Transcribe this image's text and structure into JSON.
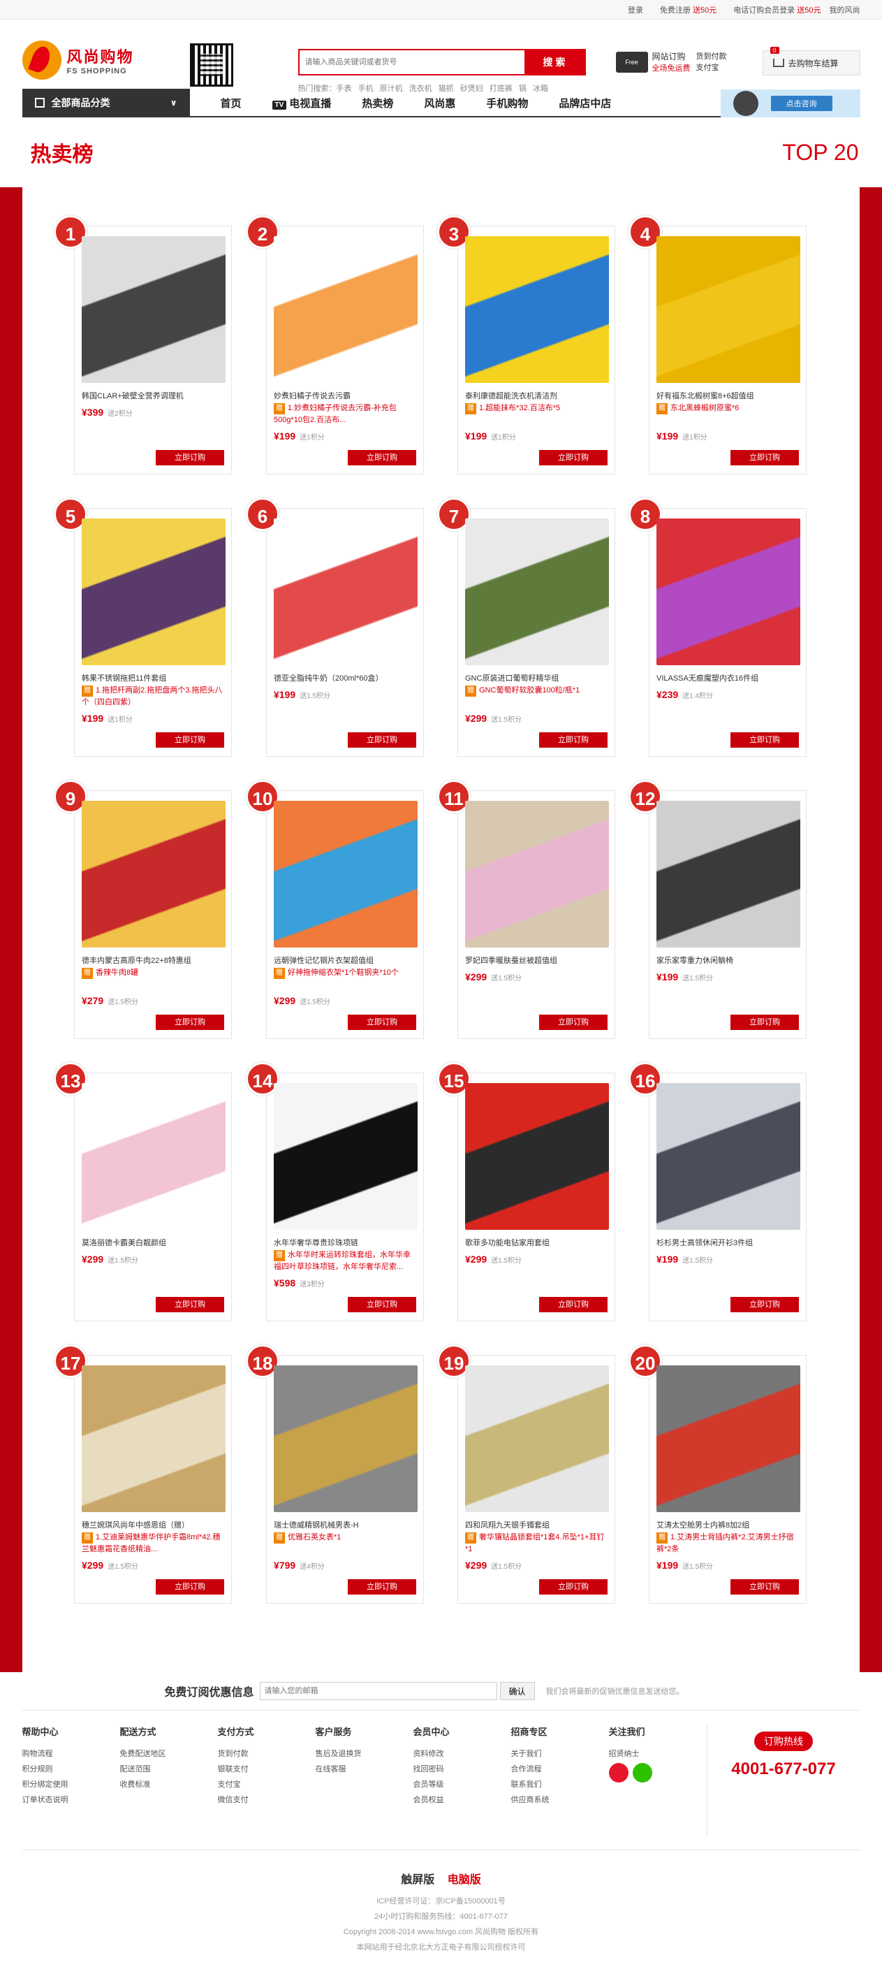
{
  "topbar": {
    "login": "登录",
    "register": "免费注册",
    "register_bonus": "送50元",
    "phone_member": "电话订购会员登录",
    "phone_bonus": "送50元",
    "my": "我的风尚"
  },
  "brand": {
    "cn": "风尚购物",
    "en": "FS SHOPPING"
  },
  "search": {
    "placeholder": "请输入商品关键词或者货号",
    "button": "搜 索"
  },
  "hot_words": [
    "热门搜索：手表",
    "手机",
    "原汁机",
    "洗衣机",
    "猫抓",
    "砂煲妇",
    "打底裤",
    "锅",
    "冰箱"
  ],
  "freeship": {
    "badge": "Free",
    "line1": "网站订购",
    "line2": "全场免运费",
    "pay1": "货到付款",
    "pay2": "支付宝"
  },
  "cart": {
    "count": "0",
    "label": "去购物车结算"
  },
  "nav": {
    "all_categories": "全部商品分类",
    "items": [
      "首页",
      "电视直播",
      "热卖榜",
      "风尚惠",
      "手机购物",
      "品牌店中店"
    ],
    "tv_badge": "TV",
    "consult": "点击咨询"
  },
  "title": {
    "main": "热卖榜",
    "top": "TOP 20"
  },
  "products": [
    {
      "rank": "1",
      "name": "韩国CLAR+破壁全营养调理机",
      "promo": "",
      "price": "¥399",
      "points": "送2积分",
      "order": "立即订购"
    },
    {
      "rank": "2",
      "name": "妙煮妇橘子传说去污霸",
      "promo": "1.妙煮妇橘子传说去污霸-补充包500g*10包2.百洁布...",
      "price": "¥199",
      "points": "送1积分",
      "order": "立即订购"
    },
    {
      "rank": "3",
      "name": "泰利康德超能洗衣机清洁剂",
      "promo": "1.超能抹布*32.百洁布*5",
      "price": "¥199",
      "points": "送1积分",
      "order": "立即订购"
    },
    {
      "rank": "4",
      "name": "好有福东北椴树蜜8+6超值组",
      "promo": "东北黑蜂椴树原蜜*6",
      "price": "¥199",
      "points": "送1积分",
      "order": "立即订购"
    },
    {
      "rank": "5",
      "name": "韩果不锈钢拖把11件套组",
      "promo": "1.拖把杆两副2.拖把盘两个3.拖把头八个（四白四紫）",
      "price": "¥199",
      "points": "送1积分",
      "order": "立即订购"
    },
    {
      "rank": "6",
      "name": "德亚全脂纯牛奶（200ml*60盒）",
      "promo": "",
      "price": "¥199",
      "points": "送1.5积分",
      "order": "立即订购"
    },
    {
      "rank": "7",
      "name": "GNC原装进口葡萄籽精华组",
      "promo": "GNC葡萄籽软胶囊100粒/瓶*1",
      "price": "¥299",
      "points": "送1.5积分",
      "order": "立即订购"
    },
    {
      "rank": "8",
      "name": "VILASSA无痕魔塑内衣16件组",
      "promo": "",
      "price": "¥239",
      "points": "送1.4积分",
      "order": "立即订购"
    },
    {
      "rank": "9",
      "name": "德丰内蒙古高原牛肉22+8特惠组",
      "promo": "香辣牛肉8罐",
      "price": "¥279",
      "points": "送1.5积分",
      "order": "立即订购"
    },
    {
      "rank": "10",
      "name": "远朝弹性记忆钢片衣架超值组",
      "promo": "好神拖伸缩衣架*1个鞋钢夹*10个",
      "price": "¥299",
      "points": "送1.5积分",
      "order": "立即订购"
    },
    {
      "rank": "11",
      "name": "罗妃四季暖肤蚕丝被超值组",
      "promo": "",
      "price": "¥299",
      "points": "送1.5积分",
      "order": "立即订购"
    },
    {
      "rank": "12",
      "name": "家乐家零重力休闲躺椅",
      "promo": "",
      "price": "¥199",
      "points": "送1.5积分",
      "order": "立即订购"
    },
    {
      "rank": "13",
      "name": "莫洛丽德卡霸美白靓颜组",
      "promo": "",
      "price": "¥299",
      "points": "送1.5积分",
      "order": "立即订购"
    },
    {
      "rank": "14",
      "name": "水年华奢华尊贵珍珠项链",
      "promo": "水年华时来运转珍珠套组，水年华幸福四叶草珍珠项链，水年华奢华尼索...",
      "price": "¥598",
      "points": "送3积分",
      "order": "立即订购"
    },
    {
      "rank": "15",
      "name": "歌菲多功能电钻家用套组",
      "promo": "",
      "price": "¥299",
      "points": "送1.5积分",
      "order": "立即订购"
    },
    {
      "rank": "16",
      "name": "杉杉男士高领休闲开衫3件组",
      "promo": "",
      "price": "¥199",
      "points": "送1.5积分",
      "order": "立即订购"
    },
    {
      "rank": "17",
      "name": "穗兰婉琪风尚年中感恩组（赠）",
      "promo": "1.艾迪莱姆魅惠华伴护手霜8ml*42.穗兰魅惠霜花香纸精油...",
      "price": "¥299",
      "points": "送1.5积分",
      "order": "立即订购"
    },
    {
      "rank": "18",
      "name": "瑞士德威精钢机械男表-H",
      "promo": "优雅石英女表*1",
      "price": "¥799",
      "points": "送4积分",
      "order": "立即订购"
    },
    {
      "rank": "19",
      "name": "四和凤翔九天银手镯套组",
      "promo": "奢华镶钻晶锁套组*1套4.吊坠*1+耳钉*1",
      "price": "¥299",
      "points": "送1.5积分",
      "order": "立即订购"
    },
    {
      "rank": "20",
      "name": "艾涛太空舱男士内裤8加2组",
      "promo": "1.艾涛男士背插内裤*2.艾涛男士抒宿裤*2条",
      "price": "¥199",
      "points": "送1.5积分",
      "order": "立即订购"
    }
  ],
  "subscribe": {
    "label": "免费订阅优惠信息",
    "placeholder": "请输入您的邮箱",
    "button": "确认",
    "hint": "我们会将最新的促销优惠信息发送给您。"
  },
  "footer": {
    "columns": [
      {
        "title": "帮助中心",
        "links": [
          "购物流程",
          "积分规则",
          "积分绑定使用",
          "订单状态说明"
        ]
      },
      {
        "title": "配送方式",
        "links": [
          "免费配送地区",
          "配送范围",
          "收费标准"
        ]
      },
      {
        "title": "支付方式",
        "links": [
          "货到付款",
          "银联支付",
          "支付宝",
          "微信支付"
        ]
      },
      {
        "title": "客户服务",
        "links": [
          "售后及退换货",
          "在线客服"
        ]
      },
      {
        "title": "会员中心",
        "links": [
          "资料修改",
          "找回密码",
          "会员等级",
          "会员权益"
        ]
      },
      {
        "title": "招商专区",
        "links": [
          "关于我们",
          "合作流程",
          "联系我们",
          "供应商系统"
        ]
      },
      {
        "title": "关注我们",
        "links": [
          "招贤纳士"
        ]
      }
    ],
    "hotline_label": "订购热线",
    "hotline_number": "4001-677-077"
  },
  "bottom": {
    "touch": "触屏版",
    "pc": "电脑版",
    "lines": [
      "ICP经营许可证：京ICP备15000001号",
      "24小时订购和服务热线：4001-677-077",
      "Copyright 2008-2014 www.fstvgo.com 风尚购物 版权所有",
      "本网站用于经北京北大方正电子有限公司授权许可"
    ]
  }
}
